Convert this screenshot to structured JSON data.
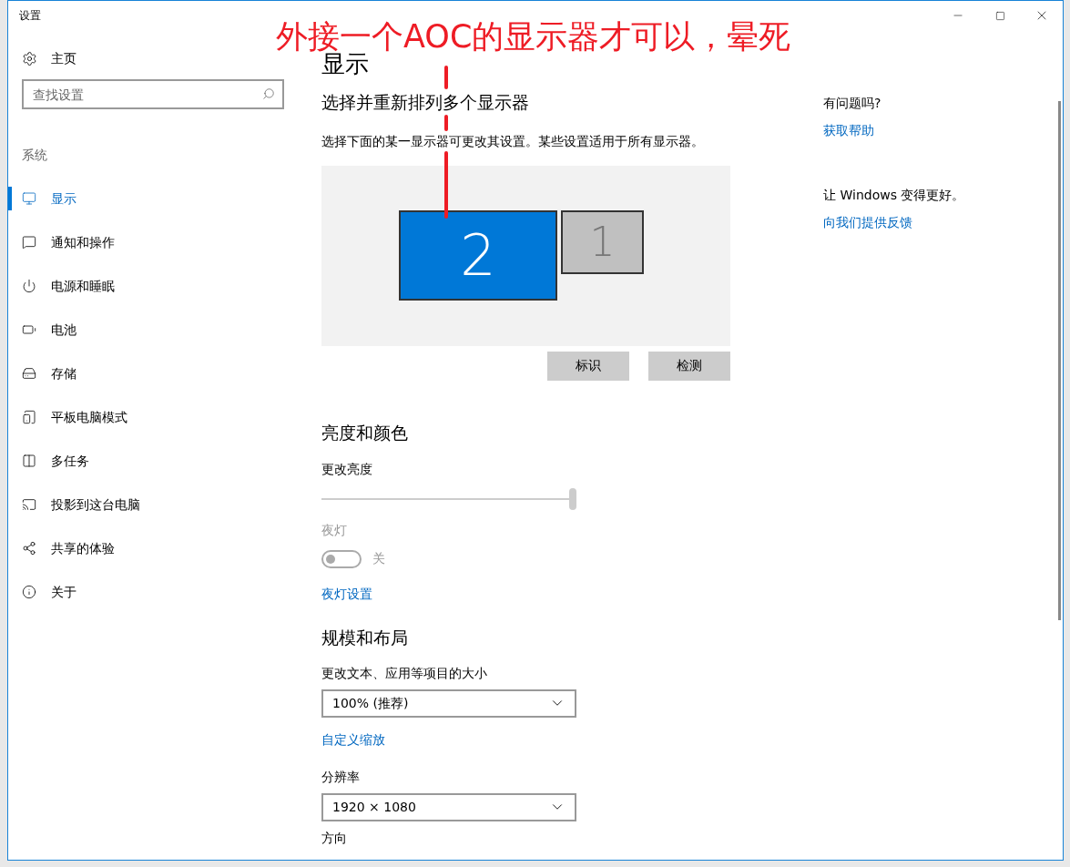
{
  "window": {
    "title": "设置"
  },
  "annotation": {
    "text": "外接一个AOC的显示器才可以，晕死"
  },
  "sidebar": {
    "home": "主页",
    "search": {
      "placeholder": "查找设置"
    },
    "section": "系统",
    "items": [
      {
        "label": "显示",
        "selected": true
      },
      {
        "label": "通知和操作",
        "selected": false
      },
      {
        "label": "电源和睡眠",
        "selected": false
      },
      {
        "label": "电池",
        "selected": false
      },
      {
        "label": "存储",
        "selected": false
      },
      {
        "label": "平板电脑模式",
        "selected": false
      },
      {
        "label": "多任务",
        "selected": false
      },
      {
        "label": "投影到这台电脑",
        "selected": false
      },
      {
        "label": "共享的体验",
        "selected": false
      },
      {
        "label": "关于",
        "selected": false
      }
    ]
  },
  "main": {
    "title": "显示",
    "arrange_heading": "选择并重新排列多个显示器",
    "arrange_hint": "选择下面的某一显示器可更改其设置。某些设置适用于所有显示器。",
    "monitors": [
      {
        "label": "2",
        "selected": true
      },
      {
        "label": "1",
        "selected": false
      }
    ],
    "buttons": [
      "标识",
      "检测"
    ],
    "brightness_heading": "亮度和颜色",
    "brightness_label": "更改亮度",
    "brightness": {
      "level": 1
    },
    "night_light": {
      "label": "夜灯",
      "on": false,
      "state_text": "关",
      "disabled": true
    },
    "night_light_link": "夜灯设置",
    "scale_heading": "规模和布局",
    "scale_label": "更改文本、应用等项目的大小",
    "scale_value": "100% (推荐)",
    "custom_scale_link": "自定义缩放",
    "resolution_label": "分辨率",
    "resolution_value": "1920 × 1080",
    "orientation_label": "方向"
  },
  "help": {
    "question": "有问题吗?",
    "help_link": "获取帮助",
    "feedback_prompt": "让 Windows 变得更好。",
    "feedback_link": "向我们提供反馈"
  }
}
